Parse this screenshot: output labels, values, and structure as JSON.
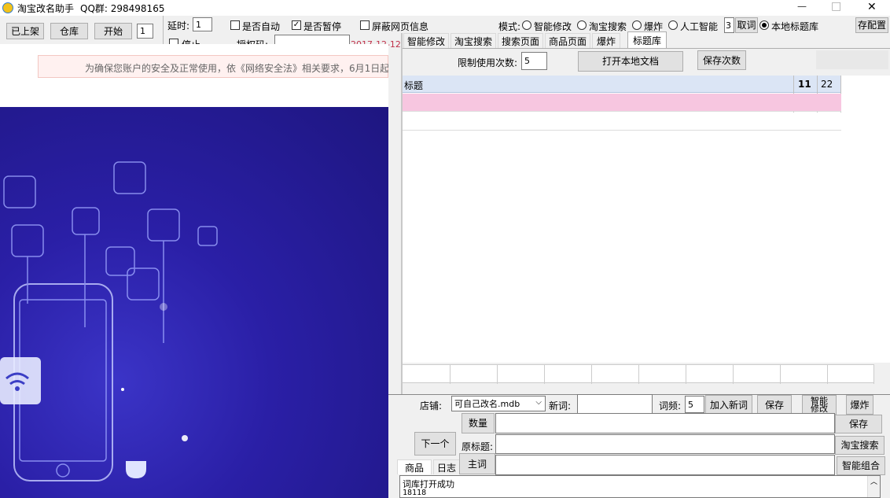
{
  "window": {
    "title": "淘宝改名助手",
    "qq": "QQ群: 298498165",
    "minimize": "—",
    "maximize": "□",
    "close": "✕"
  },
  "toolbar": {
    "shelf_btn": "已上架",
    "warehouse_btn": "仓库",
    "start_btn": "开始",
    "count_value": "1",
    "delay_label": "延时:",
    "delay_value": "1",
    "auto_label": "是否自动",
    "pause_label": "是否暂停",
    "block_label": "屏蔽网页信息",
    "stop_label": "停止",
    "auth_label": "授权码:",
    "auth_value": "",
    "date": "2017-12-12",
    "mode_label": "模式:",
    "modes": [
      "智能修改",
      "淘宝搜索",
      "爆炸",
      "人工智能"
    ],
    "mode_num": "3",
    "cancel_btn": "取词",
    "local_db_label": "本地标题库",
    "save_config_btn": "存配置"
  },
  "banner": {
    "text": "为确保您账户的安全及正常使用，依《网络安全法》相关要求，6月1日起"
  },
  "tabs": [
    "智能修改",
    "淘宝搜索",
    "搜索页面",
    "商品页面",
    "爆炸",
    "标题库"
  ],
  "title_lib": {
    "limit_label": "限制使用次数:",
    "limit_value": "5",
    "open_doc_btn": "打开本地文档",
    "save_count_btn": "保存次数",
    "table_header": [
      "标题",
      "11",
      "22"
    ]
  },
  "bottom": {
    "shop_label": "店铺:",
    "shop_value": "可自己改名.mdb",
    "new_word_label": "新词:",
    "new_word_value": "",
    "freq_label": "词频:",
    "freq_value": "5",
    "add_word_btn": "加入新词",
    "save_btn": "保存",
    "smart_edit_btn": "智能修改",
    "explode_btn": "爆炸",
    "count_btn": "数量",
    "save_btn2": "保存",
    "next_btn": "下一个",
    "orig_title_label": "原标题:",
    "taobao_search_btn": "淘宝搜索",
    "main_word_btn": "主词",
    "smart_combo_btn": "智能组合",
    "tab_goods": "商品",
    "tab_log": "日志",
    "log_line1": "词库打开成功",
    "log_line2": "18118"
  }
}
